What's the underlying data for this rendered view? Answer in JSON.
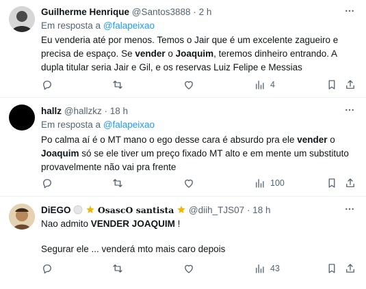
{
  "tweets": [
    {
      "author": "Guilherme Henrique",
      "handle": "@Santos3888",
      "time": "· 2 h",
      "reply_prefix": "Em resposta a",
      "reply_to": "@falapeixao",
      "text_parts": [
        "Eu venderia até por menos. Temos o Jair que é um excelente zagueiro e precisa de espaço. Se ",
        "vender",
        " o ",
        "Joaquim",
        ", teremos dinheiro entrando. A dupla titular seria Jair e Gil, e os reservas Luiz Felipe e Messias"
      ],
      "views": "4"
    },
    {
      "author": "hallz",
      "handle": "@hallzkz",
      "time": "· 18 h",
      "reply_prefix": "Em resposta a",
      "reply_to": "@falapeixao",
      "text_parts": [
        "Po calma aí é o MT mano o ego desse cara é absurdo pra ele ",
        "vender",
        " o ",
        "Joaquim",
        " só se ele tiver um preço fixado MT alto e em mente um substituto provavelmente não vai pra frente"
      ],
      "views": "100"
    },
    {
      "author": "DiEGO",
      "fancy_name": "𝐎𝐬𝐚𝐬𝐜𝐎 𝐬𝐚𝐧𝐭𝐢𝐬𝐭𝐚",
      "handle": "@diih_TJS07",
      "time": "· 18 h",
      "line1_prefix": "Nao admito ",
      "line1_bold": "VENDER JOAQUIM",
      "line1_suffix": " !",
      "line2": "Segurar ele ... venderá mto mais caro depois",
      "views": "43"
    }
  ],
  "colors": {
    "text": "#0f1419",
    "secondary": "#536471",
    "accent": "#1d9bf0",
    "divider": "#eff3f4",
    "star": "#f5b400"
  },
  "icons": [
    "more-icon",
    "reply-icon",
    "retweet-icon",
    "like-icon",
    "views-icon",
    "bookmark-icon",
    "share-icon",
    "star-icon"
  ]
}
